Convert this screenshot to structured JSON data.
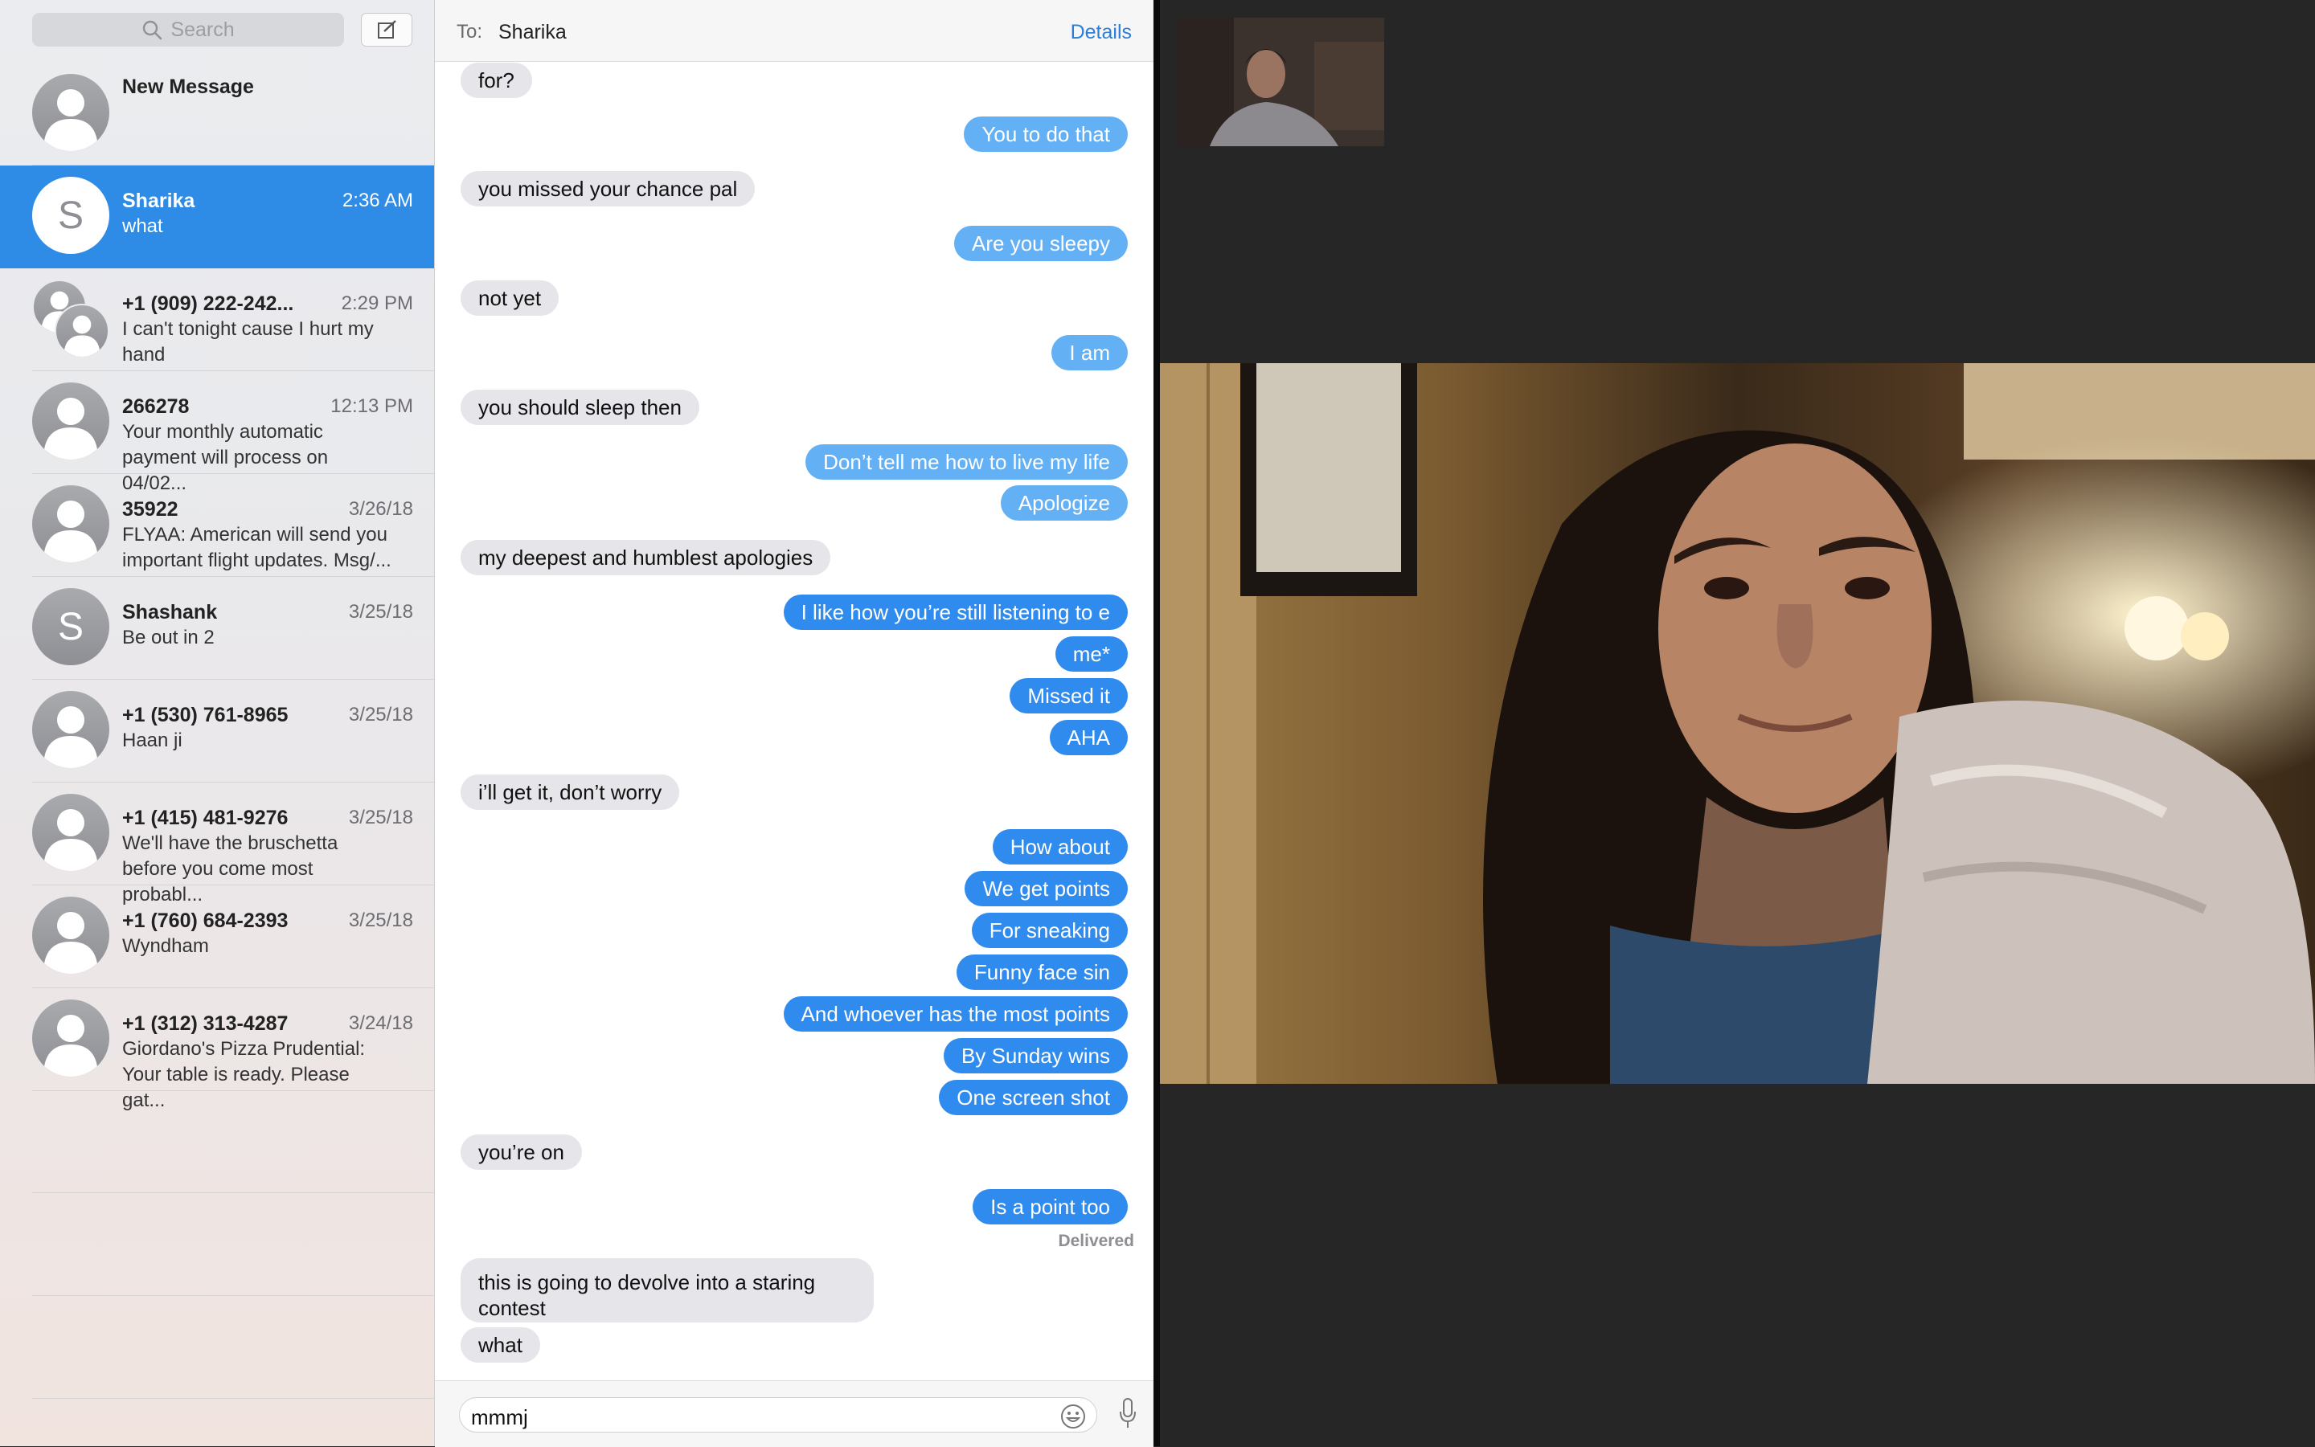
{
  "sidebar": {
    "search_placeholder": "Search",
    "conversations": [
      {
        "name": "New Message",
        "time": "",
        "preview": ""
      },
      {
        "name": "Sharika",
        "time": "2:36 AM",
        "preview": "what",
        "initial": "S"
      },
      {
        "name": "+1 (909) 222-242...",
        "time": "2:29 PM",
        "preview": "I can't tonight cause I hurt my hand"
      },
      {
        "name": "266278",
        "time": "12:13 PM",
        "preview": "Your monthly automatic payment will process on 04/02..."
      },
      {
        "name": "35922",
        "time": "3/26/18",
        "preview": "FLYAA: American will send you important flight updates. Msg/..."
      },
      {
        "name": "Shashank",
        "time": "3/25/18",
        "preview": "Be out in 2",
        "initial": "S"
      },
      {
        "name": "+1 (530) 761-8965",
        "time": "3/25/18",
        "preview": "Haan ji"
      },
      {
        "name": "+1 (415) 481-9276",
        "time": "3/25/18",
        "preview": "We'll have the bruschetta before you come most probabl..."
      },
      {
        "name": "+1 (760) 684-2393",
        "time": "3/25/18",
        "preview": "Wyndham"
      },
      {
        "name": "+1 (312) 313-4287",
        "time": "3/24/18",
        "preview": "Giordano's Pizza Prudential: Your table is ready. Please gat..."
      }
    ]
  },
  "chat": {
    "to_label": "To:",
    "recipient": "Sharika",
    "details_label": "Details",
    "messages": [
      {
        "dir": "in",
        "text": "for?"
      },
      {
        "dir": "out",
        "text": "You to do that"
      },
      {
        "dir": "in",
        "text": "you missed your chance pal"
      },
      {
        "dir": "out",
        "text": "Are you sleepy"
      },
      {
        "dir": "in",
        "text": "not yet"
      },
      {
        "dir": "out",
        "text": "I am"
      },
      {
        "dir": "in",
        "text": "you should sleep then"
      },
      {
        "dir": "out",
        "text": "Don’t tell me how to live my life"
      },
      {
        "dir": "out",
        "text": "Apologize"
      },
      {
        "dir": "in",
        "text": "my deepest and humblest apologies"
      },
      {
        "dir": "out",
        "text": "I like how you’re still listening to e"
      },
      {
        "dir": "out",
        "text": "me*"
      },
      {
        "dir": "out",
        "text": "Missed it"
      },
      {
        "dir": "out",
        "text": "AHA"
      },
      {
        "dir": "in",
        "text": "i’ll get it, don’t worry"
      },
      {
        "dir": "out",
        "text": "How about"
      },
      {
        "dir": "out",
        "text": "We get points"
      },
      {
        "dir": "out",
        "text": "For sneaking"
      },
      {
        "dir": "out",
        "text": "Funny face sin"
      },
      {
        "dir": "out",
        "text": "And whoever has the most points"
      },
      {
        "dir": "out",
        "text": "By Sunday wins"
      },
      {
        "dir": "out",
        "text": "One screen shot"
      },
      {
        "dir": "in",
        "text": "you’re on"
      },
      {
        "dir": "out",
        "text": "Is a point too"
      },
      {
        "dir": "in",
        "text": "this is going to devolve into a staring contest"
      },
      {
        "dir": "in",
        "text": "what"
      }
    ],
    "delivered_label": "Delivered",
    "input_value": "mmmj"
  },
  "facetime": {
    "self_view": "self-camera",
    "remote_view": "remote-camera"
  }
}
